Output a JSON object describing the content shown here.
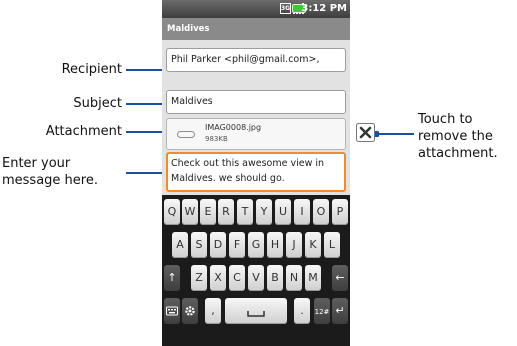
{
  "callouts": {
    "recipient": "Recipient",
    "subject": "Subject",
    "attachment": "Attachment",
    "message_line1": "Enter your",
    "message_line2": "message here.",
    "remove_line1": "Touch to",
    "remove_line2": "remove the",
    "remove_line3": "attachment."
  },
  "status": {
    "time": "3:12 PM"
  },
  "title": "Maldives",
  "compose": {
    "to": "Phil Parker <phil@gmail.com>,",
    "subject": "Maldives",
    "attachment_name": "IMAG0008.jpg",
    "attachment_size": "983KB",
    "body": "Check out this awesome view in Maldives. we should go."
  },
  "keyboard": {
    "row1": [
      "Q",
      "W",
      "E",
      "R",
      "T",
      "Y",
      "U",
      "I",
      "O",
      "P"
    ],
    "row2": [
      "A",
      "S",
      "D",
      "F",
      "G",
      "H",
      "J",
      "K",
      "L"
    ],
    "row3": [
      "Z",
      "X",
      "C",
      "V",
      "B",
      "N",
      "M"
    ],
    "shift": "↑",
    "del": "←",
    "comma": ",",
    "period": ".",
    "numbers": "12#",
    "enter": "↵"
  },
  "colors": {
    "leader": "#1c4fa0",
    "focus_border": "#f08c2e",
    "battery": "#46c33a"
  }
}
